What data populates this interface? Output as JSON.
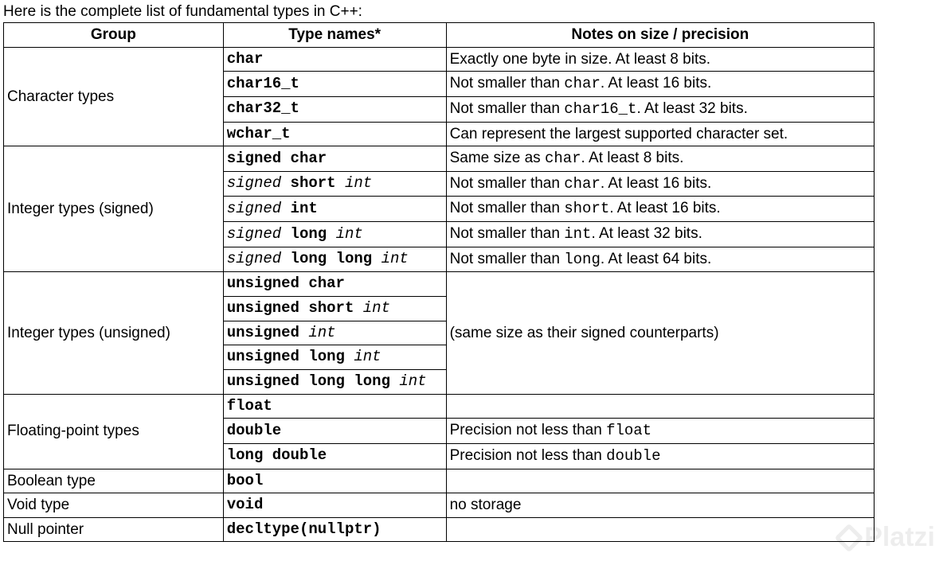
{
  "intro": "Here is the complete list of fundamental types in C++:",
  "headers": {
    "group": "Group",
    "typenames": "Type names*",
    "notes": "Notes on size / precision"
  },
  "groups": [
    {
      "label": "Character types",
      "rows": [
        {
          "type": [
            [
              "b",
              "char"
            ]
          ],
          "note": [
            [
              "t",
              "Exactly one byte in size. At least 8 bits."
            ]
          ]
        },
        {
          "type": [
            [
              "b",
              "char16_t"
            ]
          ],
          "note": [
            [
              "t",
              "Not smaller than "
            ],
            [
              "c",
              "char"
            ],
            [
              "t",
              ". At least 16 bits."
            ]
          ]
        },
        {
          "type": [
            [
              "b",
              "char32_t"
            ]
          ],
          "note": [
            [
              "t",
              "Not smaller than "
            ],
            [
              "c",
              "char16_t"
            ],
            [
              "t",
              ". At least 32 bits."
            ]
          ]
        },
        {
          "type": [
            [
              "b",
              "wchar_t"
            ]
          ],
          "note": [
            [
              "t",
              "Can represent the largest supported character set."
            ]
          ]
        }
      ]
    },
    {
      "label": "Integer types (signed)",
      "rows": [
        {
          "type": [
            [
              "b",
              "signed char"
            ]
          ],
          "note": [
            [
              "t",
              "Same size as "
            ],
            [
              "c",
              "char"
            ],
            [
              "t",
              ". At least 8 bits."
            ]
          ]
        },
        {
          "type": [
            [
              "i",
              "signed"
            ],
            [
              "b",
              " short "
            ],
            [
              "i",
              "int"
            ]
          ],
          "note": [
            [
              "t",
              "Not smaller than "
            ],
            [
              "c",
              "char"
            ],
            [
              "t",
              ". At least 16 bits."
            ]
          ]
        },
        {
          "type": [
            [
              "i",
              "signed"
            ],
            [
              "b",
              " int"
            ]
          ],
          "note": [
            [
              "t",
              "Not smaller than "
            ],
            [
              "c",
              "short"
            ],
            [
              "t",
              ". At least 16 bits."
            ]
          ]
        },
        {
          "type": [
            [
              "i",
              "signed"
            ],
            [
              "b",
              " long "
            ],
            [
              "i",
              "int"
            ]
          ],
          "note": [
            [
              "t",
              "Not smaller than "
            ],
            [
              "c",
              "int"
            ],
            [
              "t",
              ". At least 32 bits."
            ]
          ]
        },
        {
          "type": [
            [
              "i",
              "signed"
            ],
            [
              "b",
              " long long "
            ],
            [
              "i",
              "int"
            ]
          ],
          "note": [
            [
              "t",
              "Not smaller than "
            ],
            [
              "c",
              "long"
            ],
            [
              "t",
              ". At least 64 bits."
            ]
          ]
        }
      ]
    },
    {
      "label": "Integer types (unsigned)",
      "mergeNotes": true,
      "mergedNote": [
        [
          "t",
          "(same size as their signed counterparts)"
        ]
      ],
      "rows": [
        {
          "type": [
            [
              "b",
              "unsigned char"
            ]
          ]
        },
        {
          "type": [
            [
              "b",
              "unsigned short "
            ],
            [
              "i",
              "int"
            ]
          ]
        },
        {
          "type": [
            [
              "b",
              "unsigned "
            ],
            [
              "i",
              "int"
            ]
          ]
        },
        {
          "type": [
            [
              "b",
              "unsigned long "
            ],
            [
              "i",
              "int"
            ]
          ]
        },
        {
          "type": [
            [
              "b",
              "unsigned long long "
            ],
            [
              "i",
              "int"
            ]
          ]
        }
      ]
    },
    {
      "label": "Floating-point types",
      "rows": [
        {
          "type": [
            [
              "b",
              "float"
            ]
          ],
          "note": [
            [
              "t",
              ""
            ]
          ]
        },
        {
          "type": [
            [
              "b",
              "double"
            ]
          ],
          "note": [
            [
              "t",
              "Precision not less than "
            ],
            [
              "c",
              "float"
            ]
          ]
        },
        {
          "type": [
            [
              "b",
              "long double"
            ]
          ],
          "note": [
            [
              "t",
              "Precision not less than "
            ],
            [
              "c",
              "double"
            ]
          ]
        }
      ]
    },
    {
      "label": "Boolean type",
      "rows": [
        {
          "type": [
            [
              "b",
              "bool"
            ]
          ],
          "note": [
            [
              "t",
              ""
            ]
          ]
        }
      ]
    },
    {
      "label": "Void type",
      "rows": [
        {
          "type": [
            [
              "b",
              "void"
            ]
          ],
          "note": [
            [
              "t",
              "no storage"
            ]
          ]
        }
      ]
    },
    {
      "label": "Null pointer",
      "rows": [
        {
          "type": [
            [
              "b",
              "decltype(nullptr)"
            ]
          ],
          "note": [
            [
              "t",
              ""
            ]
          ]
        }
      ]
    }
  ],
  "watermark": "Platzi"
}
